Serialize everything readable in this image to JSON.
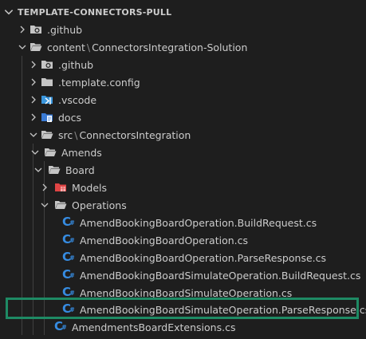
{
  "explorer": {
    "title": "TEMPLATE-CONNECTORS-PULL",
    "items": [
      {
        "label": ".github"
      },
      {
        "label": "content",
        "sub": "ConnectorsIntegration-Solution"
      },
      {
        "label": ".github"
      },
      {
        "label": ".template.config"
      },
      {
        "label": ".vscode"
      },
      {
        "label": "docs"
      },
      {
        "label": "src",
        "sub": "ConnectorsIntegration"
      },
      {
        "label": "Amends"
      },
      {
        "label": "Board"
      },
      {
        "label": "Models"
      },
      {
        "label": "Operations"
      },
      {
        "label": "AmendBookingBoardOperation.BuildRequest.cs"
      },
      {
        "label": "AmendBookingBoardOperation.cs"
      },
      {
        "label": "AmendBookingBoardOperation.ParseResponse.cs"
      },
      {
        "label": "AmendBookingBoardSimulateOperation.BuildRequest.cs"
      },
      {
        "label": "AmendBookingBoardSimulateOperation.cs"
      },
      {
        "label": "AmendBookingBoardSimulateOperation.ParseResponse.cs"
      },
      {
        "label": "AmendmentsBoardExtensions.cs"
      }
    ],
    "path_separator": "\\",
    "csharp_icon_glyph": "C",
    "csharp_icon_hash": "#"
  },
  "colors": {
    "background": "#1e1e1e",
    "text": "#cccccc",
    "folder": "#c5c5c5",
    "csharp": "#368ce2",
    "highlight_border": "#1e8a64",
    "models_folder": "#e04545",
    "vscode_folder": "#3a96dd",
    "docs_folder": "#3a7bd5"
  }
}
